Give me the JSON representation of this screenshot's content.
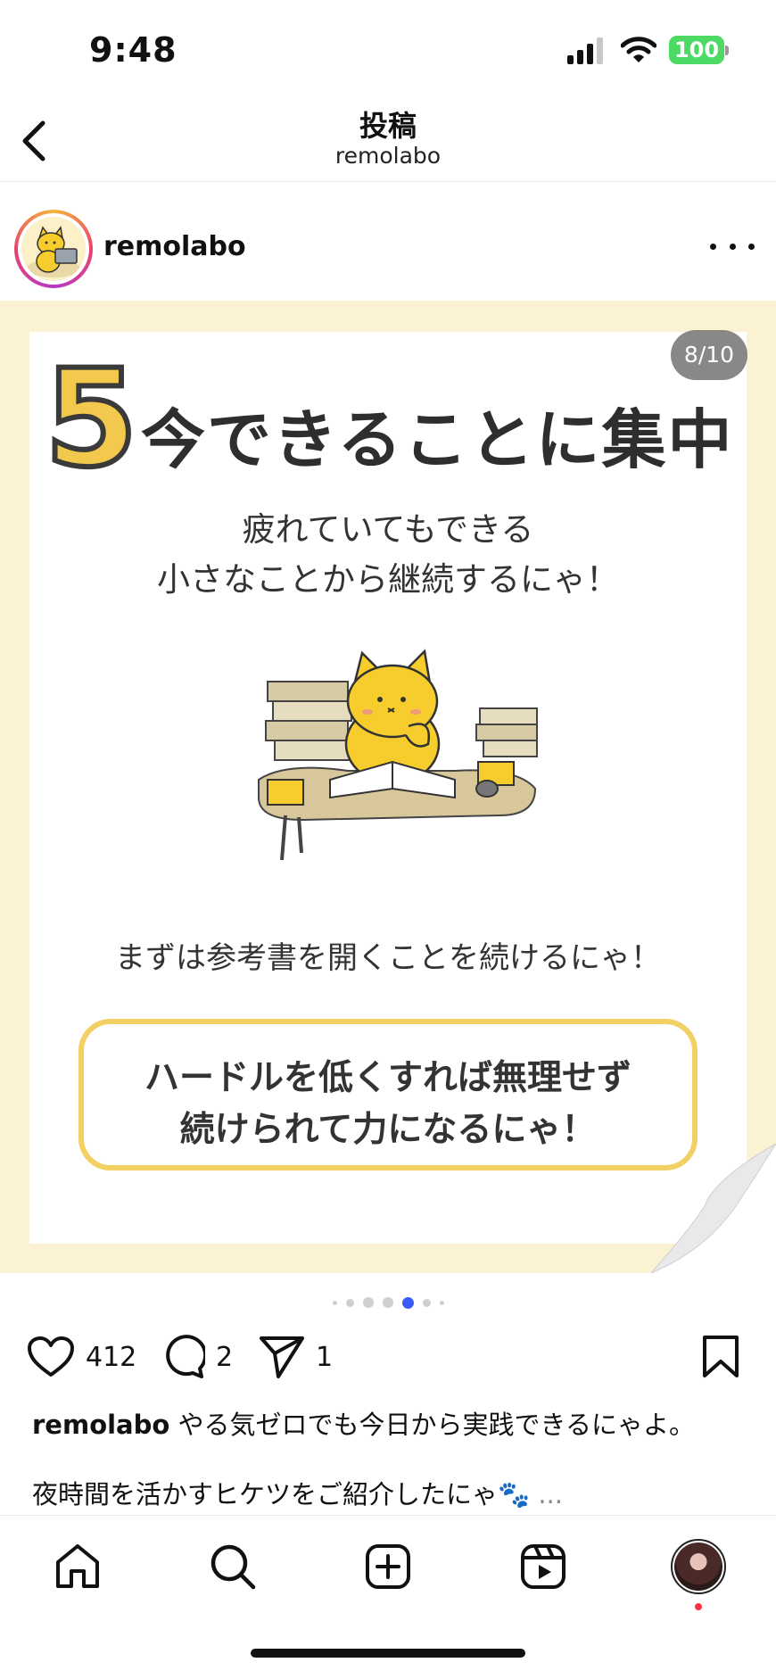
{
  "status_bar": {
    "time": "9:48",
    "battery": "100"
  },
  "header": {
    "title": "投稿",
    "subtitle": "remolabo"
  },
  "post": {
    "username": "remolabo",
    "counter": "8/10",
    "slide": {
      "number": "5",
      "title": "今できることに集中",
      "lead_line1": "疲れていてもできる",
      "lead_line2": "小さなことから継続するにゃ！",
      "note": "まずは参考書を開くことを続けるにゃ！",
      "callout_line1": "ハードルを低くすれば無理せず",
      "callout_line2": "続けられて力になるにゃ！"
    },
    "likes": "412",
    "comments": "2",
    "shares": "1",
    "caption_user": "remolabo",
    "caption_text": "やる気ゼロでも今日から実践できるにゃよ。",
    "caption_line2": "夜時間を活かすヒケツをご紹介したにゃ🐾",
    "caption_more": "..."
  },
  "icons": {
    "back": "chevron-left-icon",
    "more": "more-horizontal-icon",
    "like": "heart-icon",
    "comment": "comment-icon",
    "share": "send-icon",
    "save": "bookmark-icon",
    "home": "home-icon",
    "search": "search-icon",
    "create": "plus-square-icon",
    "reels": "reels-icon"
  },
  "colors": {
    "accent_yellow": "#f2c94c",
    "carousel_bg": "#fbf1d3",
    "active_dot": "#3b5bf6",
    "battery": "#4cd964",
    "notification": "#ff3040"
  }
}
